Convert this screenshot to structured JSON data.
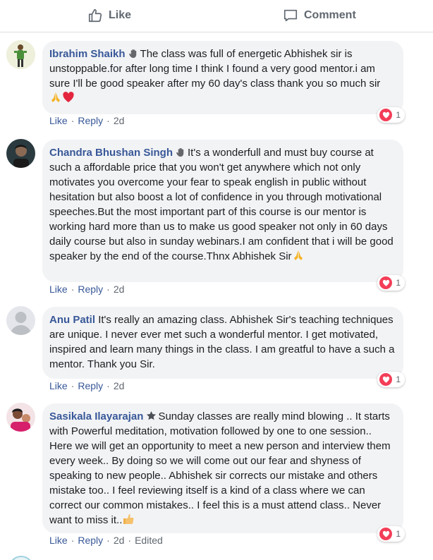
{
  "actions": {
    "like_label": "Like",
    "comment_label": "Comment"
  },
  "comments": [
    {
      "author": "Ibrahim Shaikh",
      "text": "The class was full of energetic Abhishek sir is unstoppable.for after long time I think I found a very good mentor.i am sure I'll be good speaker after my 60 day's class thank you so much sir",
      "reaction_count": "1",
      "like_label": "Like",
      "reply_label": "Reply",
      "time": "2d"
    },
    {
      "author": "Chandra Bhushan Singh",
      "text": "It's a wonderfull and must buy course at such a affordable price that you won't get anywhere which not only motivates you overcome your fear to speak english in public without hesitation but also boost a lot of confidence in you through motivational speeches.But the most important part of this course is our mentor is working hard more than us to make us good speaker not only in 60 days daily course but also in sunday webinars.I am confident that i will be good speaker by the end of the course.Thnx Abhishek Sir",
      "reaction_count": "1",
      "like_label": "Like",
      "reply_label": "Reply",
      "time": "2d"
    },
    {
      "author": "Anu Patil",
      "text": "It's really an amazing class. Abhishek Sir's teaching techniques are unique. I never ever met such a wonderful mentor. I get motivated, inspired and learn many things in the class. I am greatful to have a such a mentor. Thank you Sir.",
      "reaction_count": "1",
      "like_label": "Like",
      "reply_label": "Reply",
      "time": "2d"
    },
    {
      "author": "Sasikala Ilayarajan",
      "text": "Sunday classes are really mind blowing .. It starts with Powerful meditation, motivation followed by one to one session.. Here we will get an opportunity to meet a new person and interview them every week.. By doing so we will come out our fear and shyness of speaking to new people.. Abhishek sir corrects our mistake and others mistake too.. I feel reviewing itself is a kind of a class where we can correct our common mistakes.. I feel this is a must attend class.. Never want to miss it..",
      "reaction_count": "1",
      "like_label": "Like",
      "reply_label": "Reply",
      "time": "2d",
      "edited_label": "Edited"
    }
  ],
  "colors": {
    "link": "#385898",
    "bubble": "#f2f3f5",
    "heart": "#f33e58",
    "meta": "#606770"
  },
  "icons": {
    "like": "thumbs-up-icon",
    "comment": "comment-icon",
    "reaction": "love-reaction-icon",
    "badge_1": "wave-hand-icon",
    "badge_2": "star-icon"
  }
}
